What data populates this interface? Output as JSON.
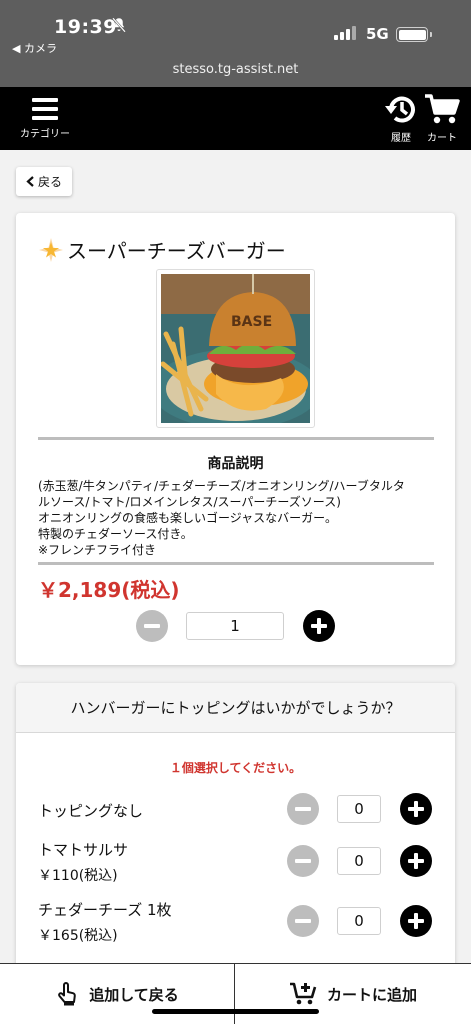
{
  "status": {
    "time": "19:39",
    "back_app": "◀ カメラ",
    "network": "5G",
    "icons": [
      "bell-off-icon",
      "signal-icon",
      "battery-icon"
    ]
  },
  "browser": {
    "url": "stesso.tg-assist.net"
  },
  "header": {
    "category_label": "カテゴリー",
    "history_label": "履歴",
    "cart_label": "カート"
  },
  "back": {
    "label": "戻る"
  },
  "product": {
    "title": "スーパーチーズバーガー",
    "title_icon": "sparkle-star-icon",
    "description_heading": "商品説明",
    "description_lines": [
      "(赤玉葱/牛タンパティ/チェダーチーズ/オニオンリング/ハーブタルタ",
      "ルソース/トマト/ロメインレタス/スーパーチーズソース)",
      "オニオンリングの食感も楽しいゴージャスなバーガー。",
      "特製のチェダーソース付き。",
      "※フレンチフライ付き"
    ],
    "price": "￥2,189(税込)",
    "quantity": "1"
  },
  "toppings": {
    "question": "ハンバーガーにトッピングはいかがでしょうか？",
    "note": "１個選択してください。",
    "options": [
      {
        "name": "トッピングなし",
        "price": "",
        "qty": "0"
      },
      {
        "name": "トマトサルサ",
        "price": "￥110(税込)",
        "qty": "0"
      },
      {
        "name": "チェダーチーズ 1枚",
        "price": "￥165(税込)",
        "qty": "0"
      }
    ]
  },
  "bottom": {
    "add_back_label": "追加して戻る",
    "add_cart_label": "カートに追加"
  },
  "colors": {
    "accent_red": "#d0352f",
    "header_black": "#000000",
    "status_gray": "#5e5e5e"
  }
}
